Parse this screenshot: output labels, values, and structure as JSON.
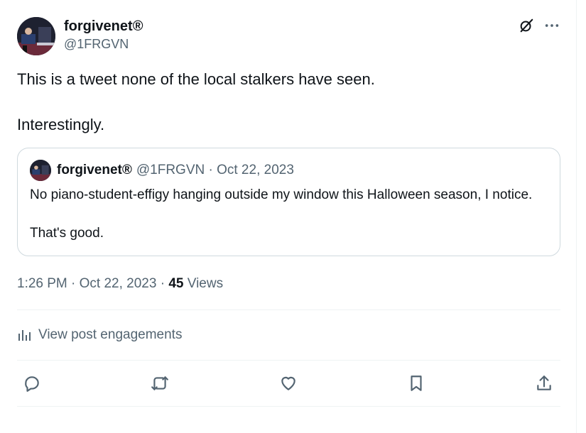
{
  "author": {
    "display_name": "forgivenet",
    "badge": "®",
    "handle": "@1FRGVN"
  },
  "header_icons": [
    "grok-icon",
    "more-icon"
  ],
  "tweet": {
    "paragraphs": [
      "This is a tweet none of the local stalkers have seen.",
      "Interestingly."
    ]
  },
  "quoted": {
    "display_name": "forgivenet",
    "badge": "®",
    "meta": "@1FRGVN · Oct 22, 2023",
    "paragraphs": [
      "No piano-student-effigy hanging outside my window this Halloween season, I notice.",
      "That's good."
    ]
  },
  "timestamp": {
    "time_date": "1:26 PM · Oct 22, 2023 · ",
    "views_count": "45",
    "views_label": " Views"
  },
  "engagements_label": "View post engagements",
  "actions": [
    "reply-icon",
    "repost-icon",
    "like-icon",
    "bookmark-icon",
    "share-icon"
  ],
  "colors": {
    "text": "#0f1419",
    "secondary": "#536471",
    "border": "#cfd9de",
    "divider": "#eff3f4"
  }
}
